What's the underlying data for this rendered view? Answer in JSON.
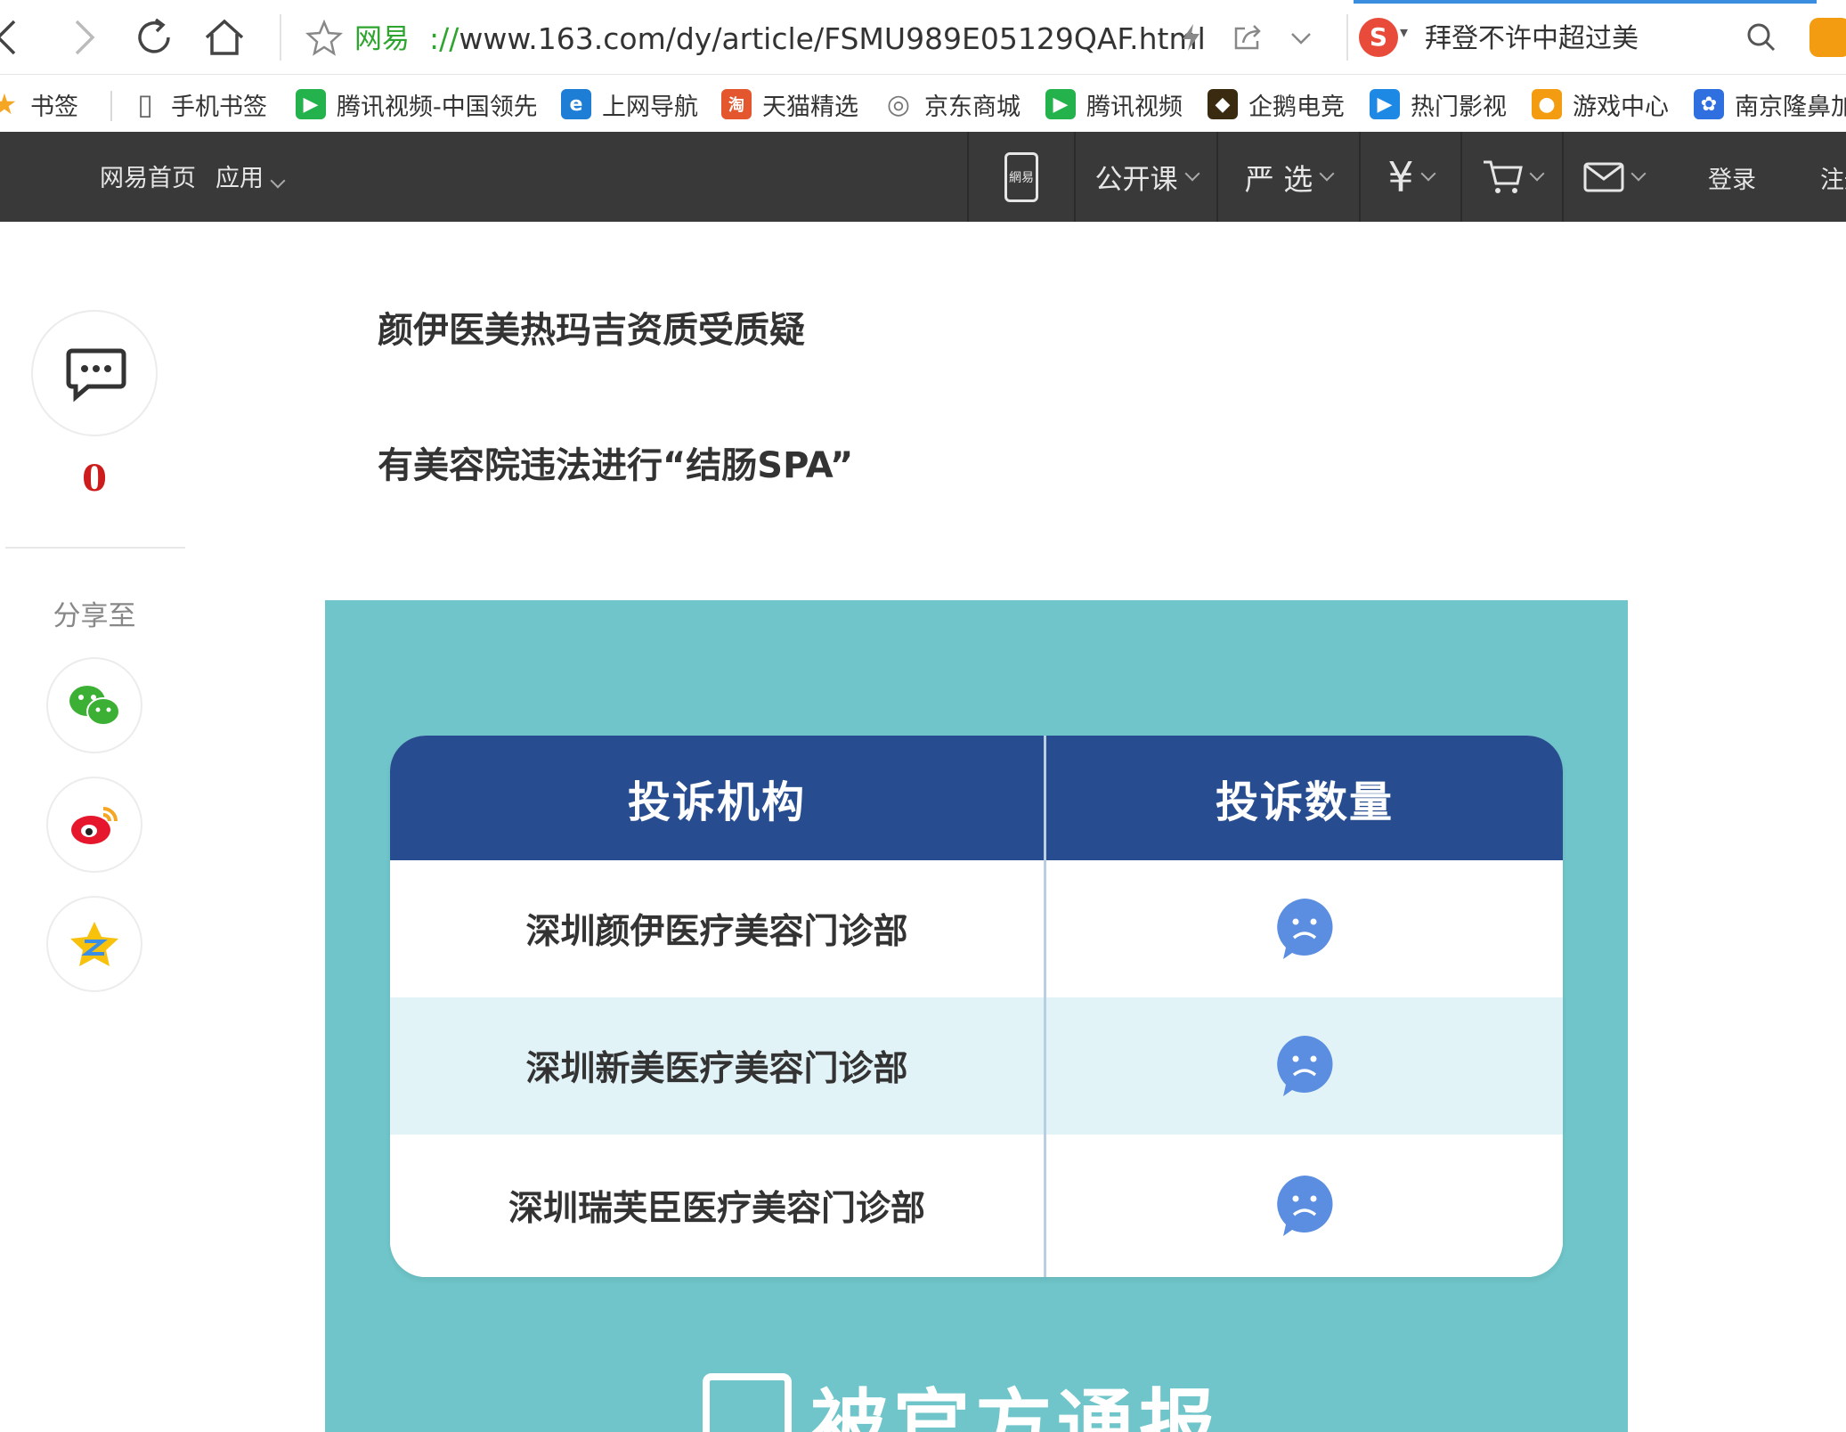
{
  "browser": {
    "site_name": "网易",
    "url_scheme": "://",
    "url_rest": "www.163.com/dy/article/FSMU989E05129QAF.html",
    "search_query": "拜登不许中超过美",
    "search_engine_glyph": "S"
  },
  "bookmarks": [
    {
      "label": "书签",
      "icon": "star-icon",
      "icon_glyph": "★",
      "color": "#f5a623"
    },
    {
      "label": "手机书签",
      "icon": "phone-icon",
      "icon_glyph": "▯",
      "color": "#666666"
    },
    {
      "label": "腾讯视频-中国领先",
      "icon": "tencent-video-icon",
      "icon_glyph": "▶",
      "color": "#23b24b"
    },
    {
      "label": "上网导航",
      "icon": "ie-icon",
      "icon_glyph": "e",
      "color": "#1e7ed6"
    },
    {
      "label": "天猫精选",
      "icon": "tmall-icon",
      "icon_glyph": "淘",
      "color": "#e4572e"
    },
    {
      "label": "京东商城",
      "icon": "globe-icon",
      "icon_glyph": "◎",
      "color": "#777777"
    },
    {
      "label": "腾讯视频",
      "icon": "tencent-video-icon",
      "icon_glyph": "▶",
      "color": "#23b24b"
    },
    {
      "label": "企鹅电竞",
      "icon": "penguin-esports-icon",
      "icon_glyph": "◆",
      "color": "#3a2a10"
    },
    {
      "label": "热门影视",
      "icon": "play-icon",
      "icon_glyph": "▶",
      "color": "#1e88e5"
    },
    {
      "label": "游戏中心",
      "icon": "gamepad-icon",
      "icon_glyph": "●",
      "color": "#f39c12"
    },
    {
      "label": "南京隆鼻加",
      "icon": "baidu-paw-icon",
      "icon_glyph": "✿",
      "color": "#2f6fe0"
    }
  ],
  "nav": {
    "home": "网易首页",
    "apps": "应用",
    "app_glyph": "網易",
    "open_course": "公开课",
    "yanxuan": "严 选",
    "yuan_glyph": "¥",
    "login": "登录",
    "register": "注册"
  },
  "share": {
    "comment_count": "0",
    "label": "分享至"
  },
  "article": {
    "heading1": "颜伊医美热玛吉资质受质疑",
    "heading2": "有美容院违法进行“结肠SPA”",
    "table": {
      "col1": "投诉机构",
      "col2": "投诉数量",
      "rows": [
        {
          "name": "深圳颜伊医疗美容门诊部",
          "count_icon": "sad-face-icon"
        },
        {
          "name": "深圳新美医疗美容门诊部",
          "count_icon": "sad-face-icon"
        },
        {
          "name": "深圳瑞芙臣医疗美容门诊部",
          "count_icon": "sad-face-icon"
        }
      ]
    },
    "banner": "被官方通报"
  },
  "colors": {
    "nav_bg": "#393939",
    "table_header": "#274d90",
    "image_bg": "#6fc5c9",
    "row_alt": "#e2f3f7",
    "sad_face": "#5b8ee0",
    "accent_red": "#cc1c1c"
  }
}
